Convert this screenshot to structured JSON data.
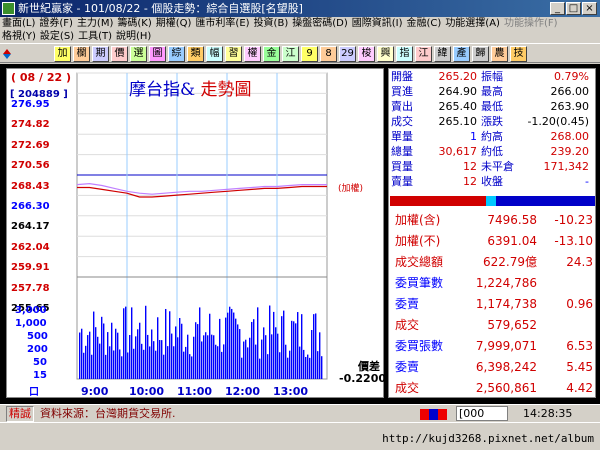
{
  "window": {
    "title": "新世紀贏家 - 101/08/22 - 個股走勢：綜合自選股[名望股]"
  },
  "menu_row1": [
    "畫面(L)",
    "證券(F)",
    "主力(M)",
    "籌碼(K)",
    "期權(Q)",
    "匯市利率(E)",
    "投資(B)",
    "操盤密碼(D)",
    "國際資訊(I)",
    "金融(C)",
    "功能選擇(A)",
    "功能操作(F)"
  ],
  "menu_row2": [
    "格視(Y)",
    "設定(S)",
    "工具(T)",
    "說明(H)"
  ],
  "toolbar": [
    "加",
    "欄",
    "期",
    "價",
    "選",
    "圖",
    "綜",
    "類",
    "幅",
    "習",
    "權",
    "金",
    "江",
    "9",
    "8",
    "29",
    "梭",
    "興",
    "指",
    "江",
    "緯",
    "產",
    "歸",
    "農",
    "技"
  ],
  "chart": {
    "code": "( 08 / 22 )",
    "serial": "[ 204889 ]",
    "title_a": "摩台指&",
    "title_b": "走勢圖",
    "price_labels": [
      {
        "text": "276.95",
        "cls": "blue"
      },
      {
        "text": "274.82",
        "cls": "red"
      },
      {
        "text": "272.69",
        "cls": "red"
      },
      {
        "text": "270.56",
        "cls": "red"
      },
      {
        "text": "268.43",
        "cls": "red"
      },
      {
        "text": "266.30",
        "cls": "blue"
      },
      {
        "text": "264.17",
        "cls": "blk"
      },
      {
        "text": "262.04",
        "cls": "red"
      },
      {
        "text": "259.91",
        "cls": "red"
      },
      {
        "text": "257.78",
        "cls": "red"
      },
      {
        "text": "255.65",
        "cls": "blk"
      }
    ],
    "volume_labels": [
      "3,000",
      "1,000",
      "500",
      "200",
      "50",
      "15",
      "口"
    ],
    "x_labels": [
      "9:00",
      "10:00",
      "11:00",
      "12:00",
      "13:00"
    ],
    "ref_label": "(加權)",
    "diff_title": "價差",
    "diff_value": "-0.2200"
  },
  "chart_data": {
    "type": "line",
    "series": [
      {
        "name": "成交",
        "x": [
          "8:45",
          "9:00",
          "9:15",
          "9:30",
          "9:45",
          "10:00",
          "10:15",
          "10:30",
          "10:45",
          "11:00",
          "11:15",
          "11:30",
          "11:45",
          "12:00",
          "12:15",
          "12:30",
          "12:45",
          "13:00",
          "13:15",
          "13:30",
          "13:45"
        ],
        "values": [
          265.0,
          265.0,
          264.8,
          264.6,
          264.4,
          264.0,
          264.0,
          264.1,
          264.2,
          264.3,
          264.4,
          264.5,
          264.6,
          264.7,
          264.8,
          264.9,
          264.9,
          265.0,
          265.1,
          265.1,
          265.1
        ]
      },
      {
        "name": "加權",
        "x": [
          "8:45",
          "9:00",
          "9:15",
          "9:30",
          "9:45",
          "10:00",
          "10:15",
          "10:30",
          "10:45",
          "11:00",
          "11:15",
          "11:30",
          "11:45",
          "12:00",
          "12:15",
          "12:30",
          "12:45",
          "13:00",
          "13:15",
          "13:30",
          "13:45"
        ],
        "values": [
          265.3,
          265.4,
          265.2,
          264.9,
          264.6,
          264.4,
          264.3,
          264.4,
          264.5,
          264.6,
          264.6,
          264.7,
          264.8,
          264.9,
          265.0,
          265.1,
          265.1,
          265.2,
          265.3,
          265.3,
          265.3
        ]
      }
    ],
    "ylim": [
      255.65,
      276.95
    ],
    "volume_scale": [
      "15",
      "50",
      "200",
      "500",
      "1,000",
      "3,000"
    ]
  },
  "quote_top": [
    {
      "k1": "開盤",
      "v1": "265.20",
      "c1": "red",
      "k2": "振幅",
      "v2": "0.79%",
      "c2": "red"
    },
    {
      "k1": "買進",
      "v1": "264.90",
      "c1": "blk",
      "k2": "最高",
      "v2": "266.00",
      "c2": "blk"
    },
    {
      "k1": "賣出",
      "v1": "265.40",
      "c1": "blk",
      "k2": "最低",
      "v2": "263.90",
      "c2": "blk"
    },
    {
      "k1": "成交",
      "v1": "265.10",
      "c1": "blk",
      "k2": "漲跌",
      "v2": "-1.20(0.45)",
      "c2": "blk"
    },
    {
      "k1": "單量",
      "v1": "1",
      "c1": "blue",
      "k2": "約高",
      "v2": "268.00",
      "c2": "red"
    },
    {
      "k1": "總量",
      "v1": "30,617",
      "c1": "red",
      "k2": "約低",
      "v2": "239.20",
      "c2": "red"
    },
    {
      "k1": "買量",
      "v1": "12",
      "c1": "red",
      "k2": "未平倉",
      "v2": "171,342",
      "c2": "red"
    },
    {
      "k1": "賣量",
      "v1": "12",
      "c1": "red",
      "k2": "收盤",
      "v2": "-",
      "c2": "blue"
    }
  ],
  "quote_bottom": [
    {
      "k": "加權(含)",
      "v": "7496.58",
      "c": "-10.23",
      "kc": "red"
    },
    {
      "k": "加權(不)",
      "v": "6391.04",
      "c": "-13.10",
      "kc": "red"
    },
    {
      "k": "成交總額",
      "v": "622.79億",
      "c": "24.3",
      "kc": "red"
    },
    {
      "k": "委買筆數",
      "v": "1,224,786",
      "c": "",
      "kc": "blue"
    },
    {
      "k": "委賣",
      "v": "1,174,738",
      "c": "0.96",
      "kc": "blue"
    },
    {
      "k": "成交",
      "v": "579,652",
      "c": "",
      "kc": "red"
    },
    {
      "k": "委買張數",
      "v": "7,999,071",
      "c": "6.53",
      "kc": "blue"
    },
    {
      "k": "委賣",
      "v": "6,398,242",
      "c": "5.45",
      "kc": "blue"
    },
    {
      "k": "成交",
      "v": "2,560,861",
      "c": "4.42",
      "kc": "red"
    }
  ],
  "status": {
    "label": "精誠",
    "source": "資料來源：台灣期貨交易所.",
    "code_field": "000",
    "clock": "14:28:35"
  },
  "watermark": "http://kujd3268.pixnet.net/album"
}
